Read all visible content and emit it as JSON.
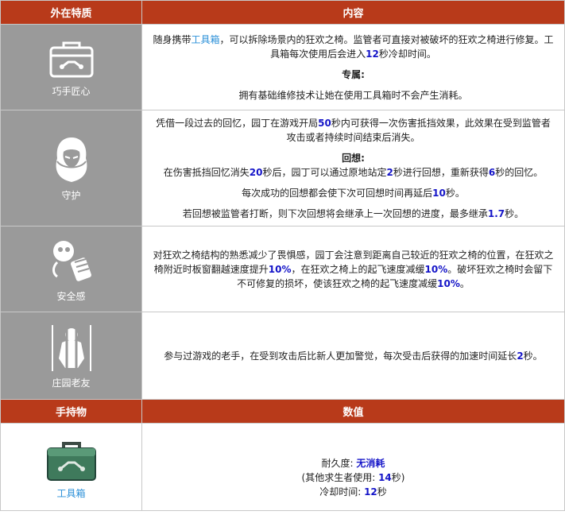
{
  "header": {
    "col1": "外在特质",
    "col2": "内容"
  },
  "traits": [
    {
      "name": "巧手匠心",
      "icon": "toolbox-icon",
      "lines": [
        [
          {
            "t": "随身携带"
          },
          {
            "t": "工具箱",
            "c": "link"
          },
          {
            "t": "，可以拆除场景内的狂欢之椅。监管者可直接对被破坏的狂欢之椅进行修复。工具箱每次使用后会进入"
          },
          {
            "t": "12",
            "c": "num"
          },
          {
            "t": "秒冷却时间。"
          }
        ]
      ],
      "subheading": "专属:",
      "sublines": [
        [
          {
            "t": "拥有基础维修技术让她在使用工具箱时不会产生消耗。"
          }
        ]
      ]
    },
    {
      "name": "守护",
      "icon": "hooded-figure-icon",
      "lines": [
        [
          {
            "t": "凭借一段过去的回忆，园丁在游戏开局"
          },
          {
            "t": "50",
            "c": "num"
          },
          {
            "t": "秒内可获得一次伤害抵挡效果，此效果在受到监管者攻击或者持续时间结束后消失。"
          }
        ]
      ],
      "subheading": "回想:",
      "sublines": [
        [
          {
            "t": "在伤害抵挡回忆消失"
          },
          {
            "t": "20",
            "c": "num"
          },
          {
            "t": "秒后，园丁可以通过原地站定"
          },
          {
            "t": "2",
            "c": "num"
          },
          {
            "t": "秒进行回想，重新获得"
          },
          {
            "t": "6",
            "c": "num"
          },
          {
            "t": "秒的回忆。"
          }
        ],
        [
          {
            "t": "每次成功的回想都会使下次可回想时间再延后"
          },
          {
            "t": "10",
            "c": "num"
          },
          {
            "t": "秒。"
          }
        ],
        [
          {
            "t": "若回想被监管者打断，则下次回想将会继承上一次回想的进度，最多继承"
          },
          {
            "t": "1.7",
            "c": "num"
          },
          {
            "t": "秒。"
          }
        ]
      ]
    },
    {
      "name": "安全感",
      "icon": "gas-mask-icon",
      "lines": [
        [
          {
            "t": "对狂欢之椅结构的熟悉减少了畏惧感，园丁会注意到距离自己较近的狂欢之椅的位置，在狂欢之椅附近时板窗翻越速度提升"
          },
          {
            "t": "10%",
            "c": "num"
          },
          {
            "t": "，在狂欢之椅上的起飞速度减缓"
          },
          {
            "t": "10%",
            "c": "num"
          },
          {
            "t": "。破坏狂欢之椅时会留下不可修复的损坏，使该狂欢之椅的起飞速度减缓"
          },
          {
            "t": "10%",
            "c": "num"
          },
          {
            "t": "。"
          }
        ]
      ],
      "subheading": "",
      "sublines": []
    },
    {
      "name": "庄园老友",
      "icon": "caged-figure-icon",
      "lines": [
        [
          {
            "t": "参与过游戏的老手，在受到攻击后比新人更加警觉，每次受击后获得的加速时间延长"
          },
          {
            "t": "2",
            "c": "num"
          },
          {
            "t": "秒。"
          }
        ]
      ],
      "subheading": "",
      "sublines": []
    }
  ],
  "item_header": {
    "col1": "手持物",
    "col2": "数值"
  },
  "item": {
    "name": "工具箱",
    "icon": "green-toolbox-icon",
    "durability_label": "耐久度:",
    "durability_value": "无消耗",
    "others_prefix": "(其他求生者使用:",
    "others_value": "14",
    "others_suffix": "秒)",
    "cooldown_label": "冷却时间:",
    "cooldown_value": "12",
    "cooldown_suffix": "秒"
  },
  "colors": {
    "header_bg": "#b83a1a",
    "trait_bg": "#9a9a9a",
    "number": "#1515c8",
    "link": "#2a8fd8"
  }
}
